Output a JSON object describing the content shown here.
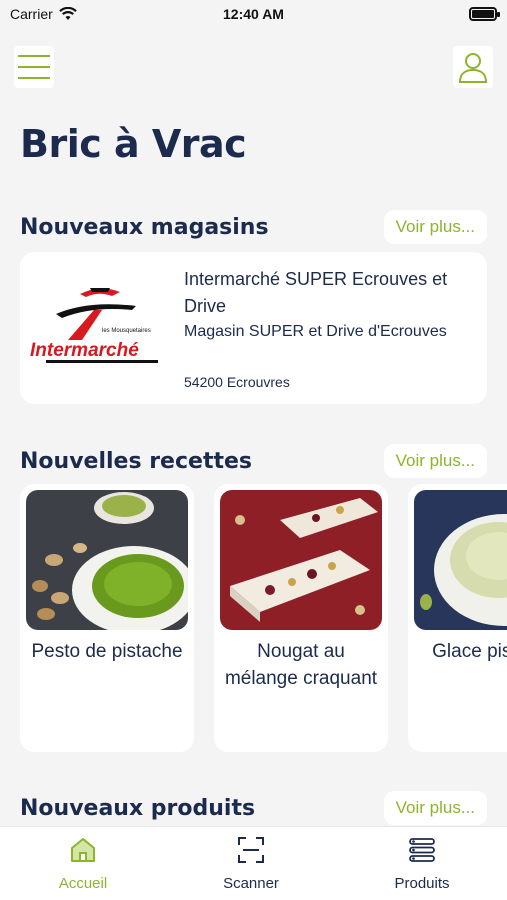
{
  "status_bar": {
    "carrier": "Carrier",
    "time": "12:40 AM"
  },
  "header": {
    "title": "Bric à Vrac"
  },
  "sections": {
    "stores": {
      "title": "Nouveaux magasins",
      "more_label": "Voir plus..."
    },
    "recipes": {
      "title": "Nouvelles recettes",
      "more_label": "Voir plus..."
    },
    "products": {
      "title": "Nouveaux produits",
      "more_label": "Voir plus..."
    }
  },
  "store": {
    "name": "Intermarché SUPER Ecrouves et Drive",
    "description": "Magasin SUPER et Drive d'Ecrouves",
    "city": "54200 Ecrouvres",
    "logo_text": "Intermarché",
    "logo_small_text": "les Mousquetaires"
  },
  "recipes": [
    {
      "title": "Pesto de pistache"
    },
    {
      "title": "Nougat au mélange craquant"
    },
    {
      "title": "Glace pistache"
    }
  ],
  "tabs": [
    {
      "label": "Accueil",
      "icon": "home-icon"
    },
    {
      "label": "Scanner",
      "icon": "scanner-icon"
    },
    {
      "label": "Produits",
      "icon": "list-icon"
    }
  ],
  "colors": {
    "accent": "#8cb52c",
    "navy": "#1c2a4d",
    "background": "#f4f4f5"
  }
}
